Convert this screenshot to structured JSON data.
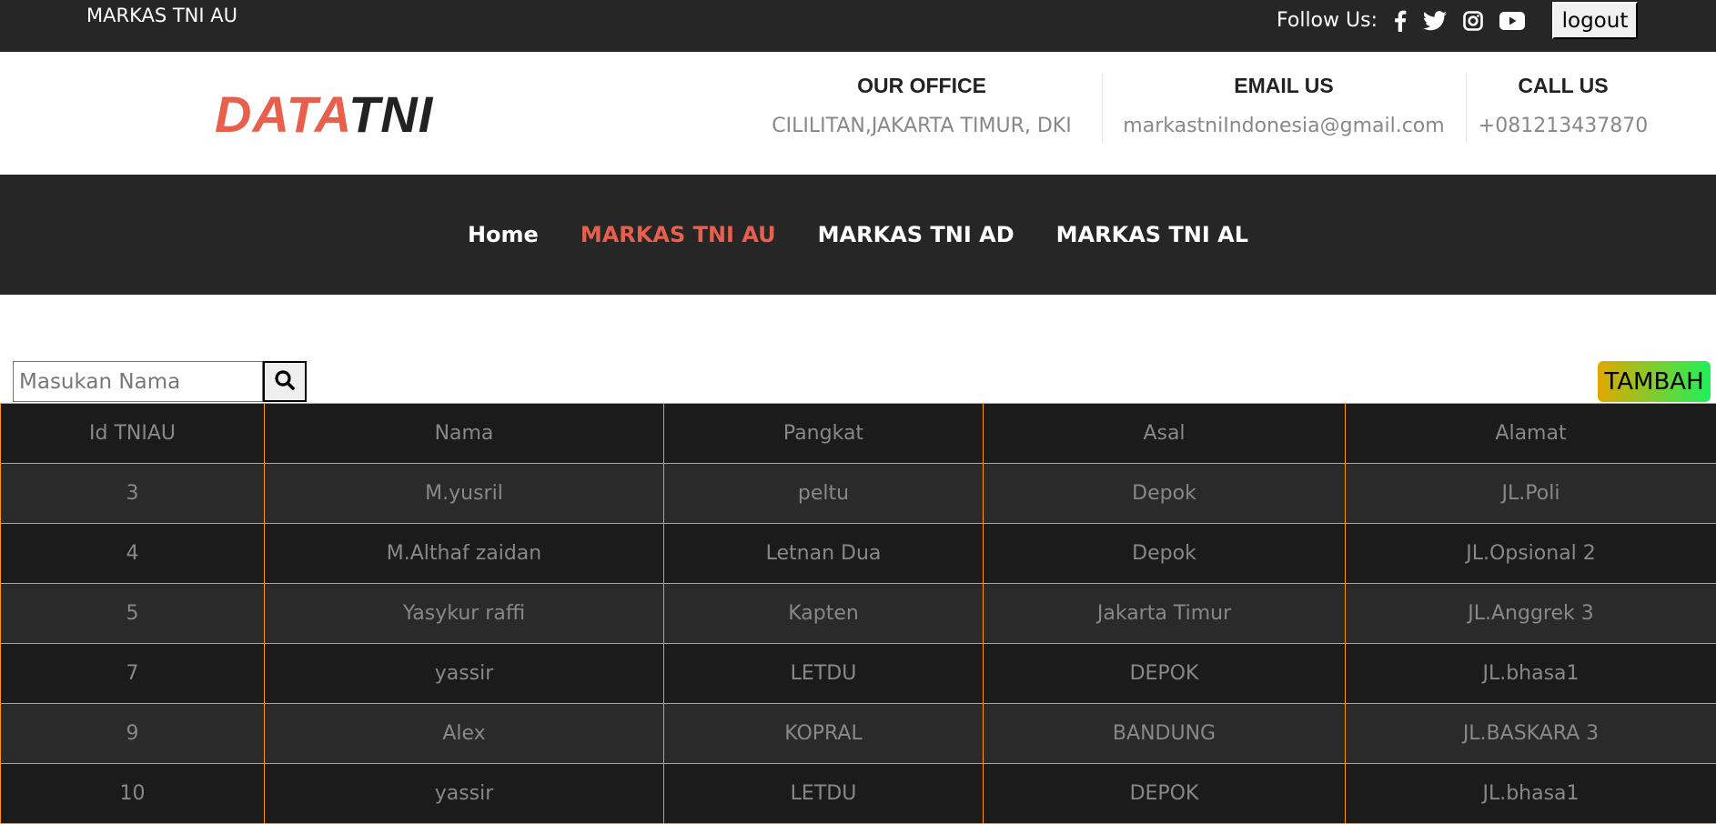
{
  "topbar": {
    "brand": "MARKAS TNI AU",
    "follow_label": "Follow Us:",
    "socials": [
      "facebook-icon",
      "twitter-icon",
      "instagram-icon",
      "youtube-icon"
    ],
    "logout": "logout"
  },
  "header": {
    "logo_a": "DATA",
    "logo_b": "TNI",
    "office": {
      "title": "OUR OFFICE",
      "value": "CILILITAN,JAKARTA TIMUR, DKI"
    },
    "email": {
      "title": "EMAIL US",
      "value": "markastniIndonesia@gmail.com"
    },
    "call": {
      "title": "CALL US",
      "value": "+081213437870"
    }
  },
  "nav": [
    {
      "label": "Home"
    },
    {
      "label": "MARKAS TNI AU"
    },
    {
      "label": "MARKAS TNI AD"
    },
    {
      "label": "MARKAS TNI AL"
    }
  ],
  "search": {
    "placeholder": "Masukan Nama"
  },
  "tambah": "TAMBAH",
  "table": {
    "headers": [
      "Id TNIAU",
      "Nama",
      "Pangkat",
      "Asal",
      "Alamat"
    ],
    "rows": [
      [
        "3",
        "M.yusril",
        "peltu",
        "Depok",
        "JL.Poli"
      ],
      [
        "4",
        "M.Althaf zaidan",
        "Letnan Dua",
        "Depok",
        "JL.Opsional 2"
      ],
      [
        "5",
        "Yasykur raffi",
        "Kapten",
        "Jakarta Timur",
        "JL.Anggrek 3"
      ],
      [
        "7",
        "yassir",
        "LETDU",
        "DEPOK",
        "JL.bhasa1"
      ],
      [
        "9",
        "Alex",
        "KOPRAL",
        "BANDUNG",
        "JL.BASKARA 3"
      ],
      [
        "10",
        "yassir",
        "LETDU",
        "DEPOK",
        "JL.bhasa1"
      ]
    ]
  },
  "colors": {
    "accent": "#e8604c",
    "border": "#ff9800",
    "dark": "#262626"
  }
}
